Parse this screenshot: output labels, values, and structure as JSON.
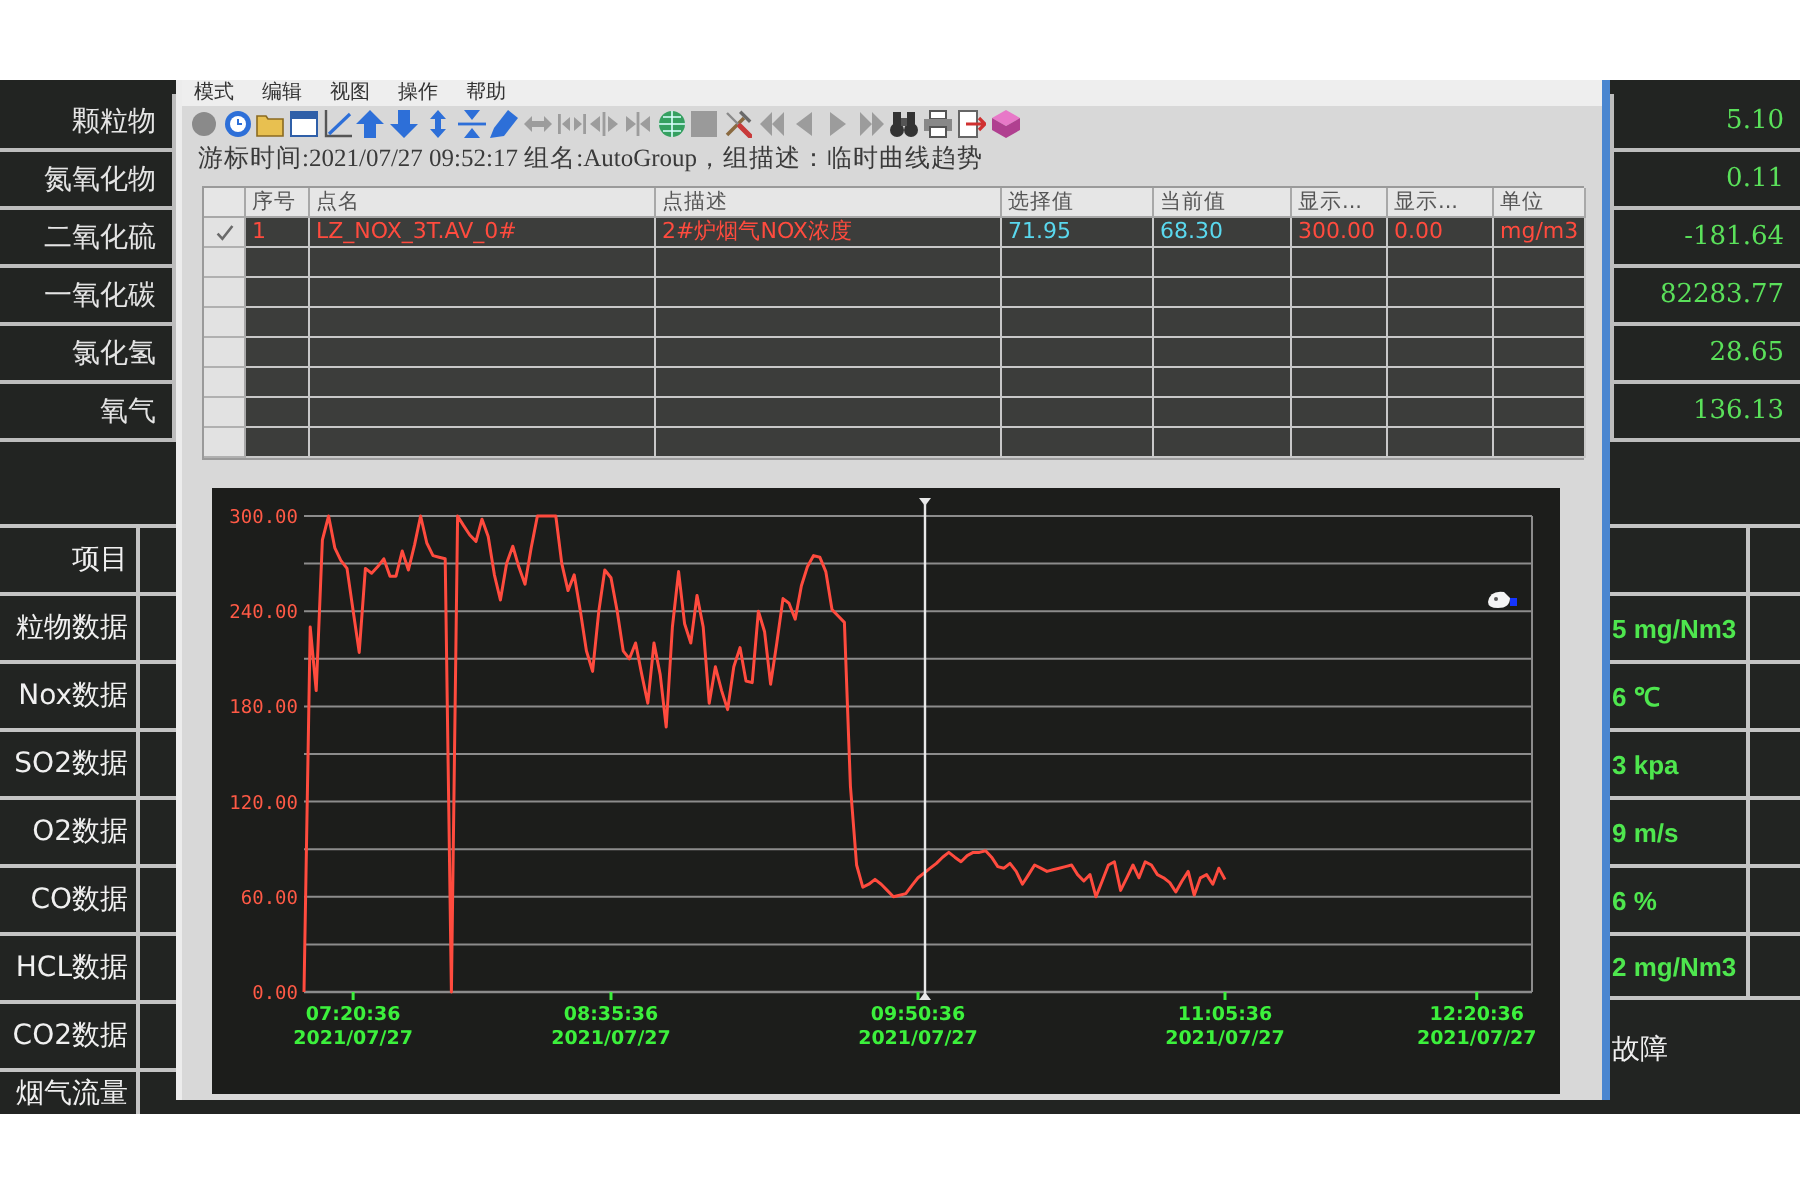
{
  "left_panel": {
    "pollutants": [
      "颗粒物",
      "氮氧化物",
      "二氧化硫",
      "一氧化碳",
      "氯化氢",
      "氧气"
    ],
    "table_header": "项目",
    "table_rows": [
      "粒物数据",
      "Nox数据",
      "SO2数据",
      "O2数据",
      "CO数据",
      "HCL数据",
      "CO2数据",
      "烟气流量"
    ]
  },
  "window": {
    "menu": [
      "模式",
      "编辑",
      "视图",
      "操作",
      "帮助"
    ],
    "info_line": "游标时间:2021/07/27 09:52:17 组名:AutoGroup，组描述：临时曲线趋势",
    "table": {
      "columns": [
        "序号",
        "点名",
        "点描述",
        "选择值",
        "当前值",
        "显示...",
        "显示...",
        "单位"
      ],
      "rows": [
        {
          "checked": true,
          "cells": [
            "1",
            "LZ_NOX_3T.AV_0#",
            "2#炉烟气NOX浓度",
            "71.95",
            "68.30",
            "300.00",
            "0.00",
            "mg/m3"
          ]
        }
      ]
    },
    "chart": {
      "chart_data": {
        "type": "line",
        "grid": true,
        "categories": [
          null,
          null,
          null,
          null,
          null,
          null,
          null,
          null,
          "07:20:36\n2021/07/27",
          null,
          null,
          null,
          null,
          null,
          null,
          null,
          null,
          null,
          null,
          null,
          null,
          null,
          null,
          null,
          null,
          null,
          null,
          null,
          null,
          null,
          null,
          null,
          null,
          null,
          null,
          null,
          null,
          null,
          null,
          null,
          null,
          null,
          null,
          null,
          null,
          null,
          null,
          null,
          null,
          null,
          "08:35:36\n2021/07/27",
          null,
          null,
          null,
          null,
          null,
          null,
          null,
          null,
          null,
          null,
          null,
          null,
          null,
          null,
          null,
          null,
          null,
          null,
          null,
          null,
          null,
          null,
          null,
          null,
          null,
          null,
          null,
          null,
          null,
          null,
          null,
          null,
          null,
          null,
          null,
          null,
          null,
          null,
          null,
          null,
          null,
          null,
          null,
          null,
          null,
          null,
          null,
          null,
          null,
          "09:50:36\n2021/07/27",
          null,
          null,
          null,
          null,
          null,
          null,
          null,
          null,
          null,
          null,
          null,
          null,
          null,
          null,
          null,
          null,
          null,
          null,
          null,
          null,
          null,
          null,
          null,
          null,
          null,
          null,
          null,
          null,
          null,
          null,
          null,
          null,
          null,
          null,
          null,
          null,
          null,
          null,
          null,
          null,
          null,
          null,
          null,
          null,
          null,
          null,
          null,
          null,
          null,
          "11:05:36\n2021/07/27",
          null,
          null,
          null,
          null,
          null,
          null,
          null,
          null,
          null,
          null,
          null,
          null,
          null,
          null,
          null,
          null,
          null,
          null,
          null,
          null,
          null,
          null,
          null,
          null,
          null,
          null,
          null,
          null,
          null,
          null,
          null,
          null,
          null,
          null,
          null,
          null,
          null,
          null,
          null,
          null,
          "12:20:36\n2021/07/27",
          null,
          null,
          null,
          null,
          null,
          null,
          null,
          null,
          null
        ],
        "series": [
          {
            "color": "#ff4b3e",
            "values": [
              0,
              230,
              190,
              285,
              300,
              280,
              272,
              267,
              240,
              214,
              267,
              264,
              268,
              273,
              262,
              262,
              278,
              266,
              282,
              300,
              283,
              275,
              274,
              273,
              0,
              300,
              294,
              288,
              284,
              298,
              287,
              263,
              247,
              270,
              281,
              268,
              257,
              280,
              300,
              300,
              300,
              300,
              270,
              253,
              263,
              240,
              215,
              202,
              240,
              266,
              261,
              240,
              215,
              210,
              220,
              200,
              182,
              220,
              200,
              167,
              230,
              265,
              232,
              220,
              250,
              230,
              182,
              205,
              190,
              178,
              205,
              217,
              196,
              195,
              240,
              227,
              194,
              220,
              248,
              245,
              235,
              256,
              268,
              275,
              274,
              265,
              241,
              237,
              233,
              130,
              80,
              66,
              68,
              71,
              68,
              64,
              60,
              61,
              62,
              67,
              72,
              75,
              78,
              81,
              85,
              88,
              85,
              82,
              86,
              88,
              88,
              89,
              85,
              79,
              78,
              81,
              76,
              68,
              74,
              80,
              78,
              76,
              77,
              78,
              79,
              80,
              74,
              70,
              74,
              60,
              70,
              80,
              82,
              64,
              72,
              80,
              72,
              82,
              80,
              74,
              72,
              69,
              63,
              70,
              76,
              61,
              72,
              74,
              68,
              78,
              71,
              null,
              null,
              null,
              null,
              null,
              null,
              null,
              null,
              null,
              null,
              null,
              null,
              null,
              null,
              null,
              null,
              null,
              null,
              null,
              null,
              null,
              null,
              null,
              null,
              null,
              null,
              null,
              null,
              null,
              null,
              null,
              null,
              null,
              null,
              null,
              null,
              null,
              null,
              null,
              null,
              null,
              null,
              null,
              null,
              null,
              null,
              null,
              null,
              null,
              null
            ]
          }
        ],
        "ylim": [
          0,
          300
        ],
        "yticks": [
          {
            "value": 0,
            "label": "0.00"
          },
          {
            "value": 60,
            "label": "60.00"
          },
          {
            "value": 120,
            "label": "120.00"
          },
          {
            "value": 180,
            "label": "180.00"
          },
          {
            "value": 240,
            "label": "240.00"
          },
          {
            "value": 300,
            "label": "300.00"
          }
        ]
      }
    }
  },
  "right_panel": {
    "readings": [
      "5.10",
      "0.11",
      "-181.64",
      "82283.77",
      "28.65",
      "136.13"
    ],
    "table_rows": [
      "5 mg/Nm3",
      "6 ℃",
      "3 kpa",
      "9 m/s",
      "6 %",
      "2 mg/Nm3"
    ],
    "status": "故障"
  }
}
